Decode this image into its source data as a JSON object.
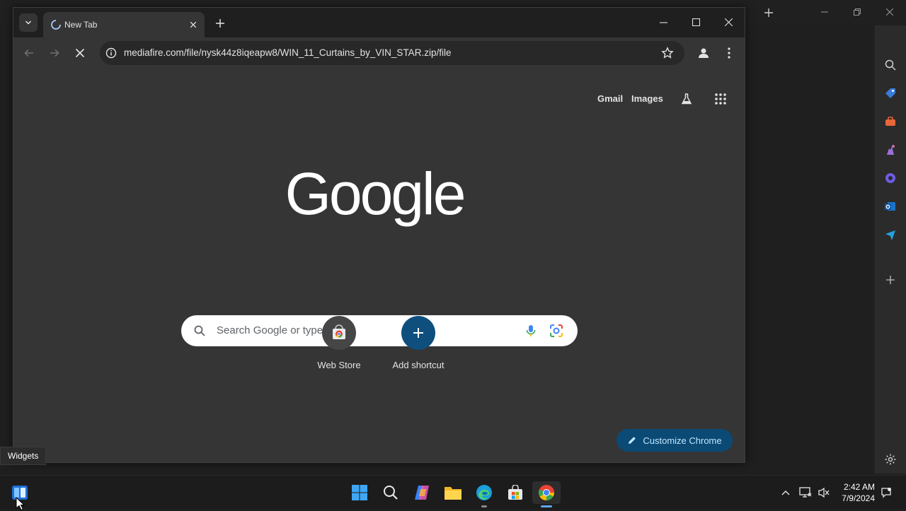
{
  "chrome": {
    "tab": {
      "title": "New Tab"
    },
    "omnibox": {
      "url": "mediafire.com/file/nysk44z8iqeapw8/WIN_11_Curtains_by_VIN_STAR.zip/file"
    },
    "header_links": {
      "gmail": "Gmail",
      "images": "Images"
    },
    "logo_text": "Google",
    "search": {
      "placeholder": "Search Google or type a URL"
    },
    "shortcuts": [
      {
        "label": "Web Store",
        "icon": "chrome-web-store-icon"
      },
      {
        "label": "Add shortcut",
        "icon": "plus-icon"
      }
    ],
    "customize_label": "Customize Chrome"
  },
  "tooltip": {
    "text": "Widgets"
  },
  "taskbar": {
    "time": "2:42 AM",
    "date": "7/9/2024",
    "icons": [
      "windows-start-icon",
      "search-icon",
      "copilot-icon",
      "file-explorer-icon",
      "edge-icon",
      "microsoft-store-icon",
      "chrome-icon"
    ]
  },
  "colors": {
    "chrome_bg": "#353535",
    "accent_button": "#0b4a75",
    "google_logo": "#ffffff"
  }
}
